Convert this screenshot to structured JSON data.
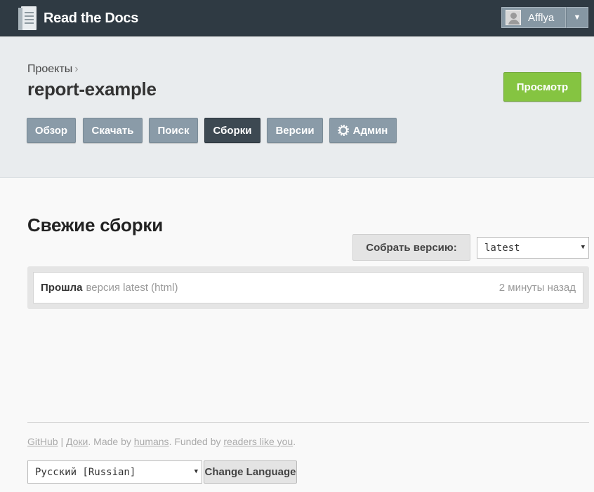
{
  "navbar": {
    "brand": "Read the Docs",
    "user": {
      "name": "Afflya"
    }
  },
  "project": {
    "breadcrumb": "Проекты",
    "breadcrumb_sep": "›",
    "title": "report-example",
    "view_label": "Просмотр",
    "tabs": [
      {
        "label": "Обзор",
        "active": false
      },
      {
        "label": "Скачать",
        "active": false
      },
      {
        "label": "Поиск",
        "active": false
      },
      {
        "label": "Сборки",
        "active": true
      },
      {
        "label": "Версии",
        "active": false
      },
      {
        "label": "Админ",
        "active": false,
        "icon": "gear-icon"
      }
    ]
  },
  "builds": {
    "title": "Свежие сборки",
    "build_button": "Собрать версию:",
    "version_selected": "latest",
    "items": [
      {
        "status": "Прошла",
        "description": "версия latest (html)",
        "time": "2 минуты назад"
      }
    ]
  },
  "footer": {
    "github": "GitHub",
    "sep": "|",
    "docs": "Доки",
    "made_by_prefix": ". Made by ",
    "humans": "humans",
    "funded_by": ". Funded by ",
    "readers": "readers like you",
    "end": ".",
    "language_selected": "Русский [Russian]",
    "change_language": "Change Language"
  },
  "colors": {
    "navbar_bg": "#2f3a43",
    "accent_green": "#85c441",
    "tab_bg": "#8a9ba8",
    "tab_active_bg": "#3d4952"
  }
}
